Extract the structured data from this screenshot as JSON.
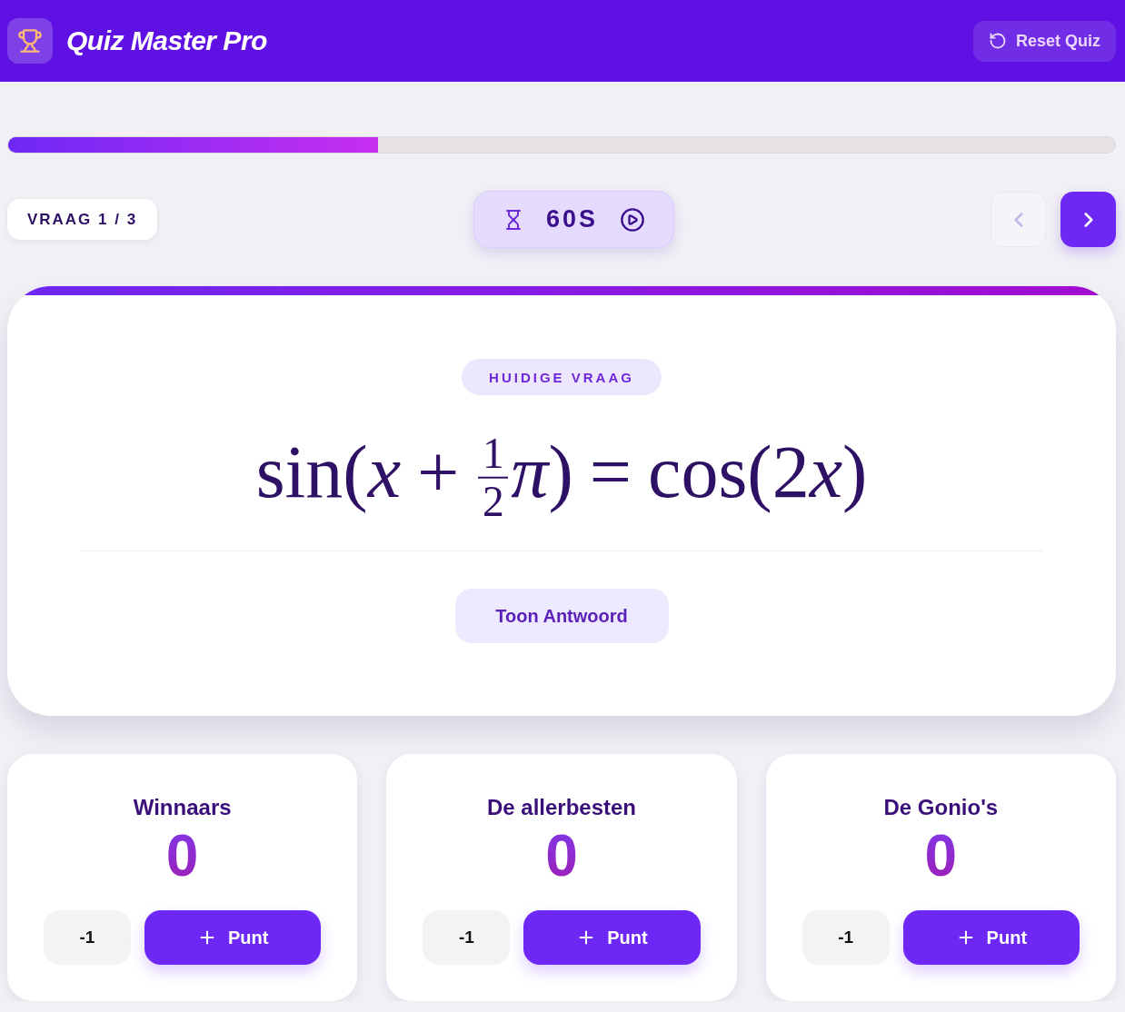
{
  "header": {
    "title": "Quiz Master Pro",
    "reset_button": "Reset Quiz"
  },
  "progress": {
    "level": 0.334
  },
  "question_counter": "VRAAG 1 / 3",
  "timer": {
    "reading": "60S",
    "running": false
  },
  "navigation": {
    "previous": {
      "disabled": true
    },
    "next": {
      "disabled": false
    }
  },
  "question": {
    "badge": "HUIDIGE VRAAG",
    "formula": [
      {
        "kind": "text",
        "text": "sin("
      },
      {
        "kind": "italic",
        "text": "x"
      },
      {
        "kind": "op",
        "text": "+"
      },
      {
        "kind": "fraction",
        "numerator": "1",
        "denominator": "2"
      },
      {
        "kind": "italic",
        "text": "π"
      },
      {
        "kind": "text",
        "text": ")"
      },
      {
        "kind": "op",
        "text": "="
      },
      {
        "kind": "text",
        "text": "cos(2"
      },
      {
        "kind": "italic",
        "text": "x"
      },
      {
        "kind": "text",
        "text": ")"
      }
    ],
    "answer_button": "Toon Antwoord"
  },
  "teams": [
    {
      "name": "Winnaars",
      "score": "0",
      "minus_button": "-1",
      "plus_button": "Punt"
    },
    {
      "name": "De allerbesten",
      "score": "0",
      "minus_button": "-1",
      "plus_button": "Punt"
    },
    {
      "name": "De Gonio's",
      "score": "0",
      "minus_button": "-1",
      "plus_button": "Punt"
    }
  ]
}
